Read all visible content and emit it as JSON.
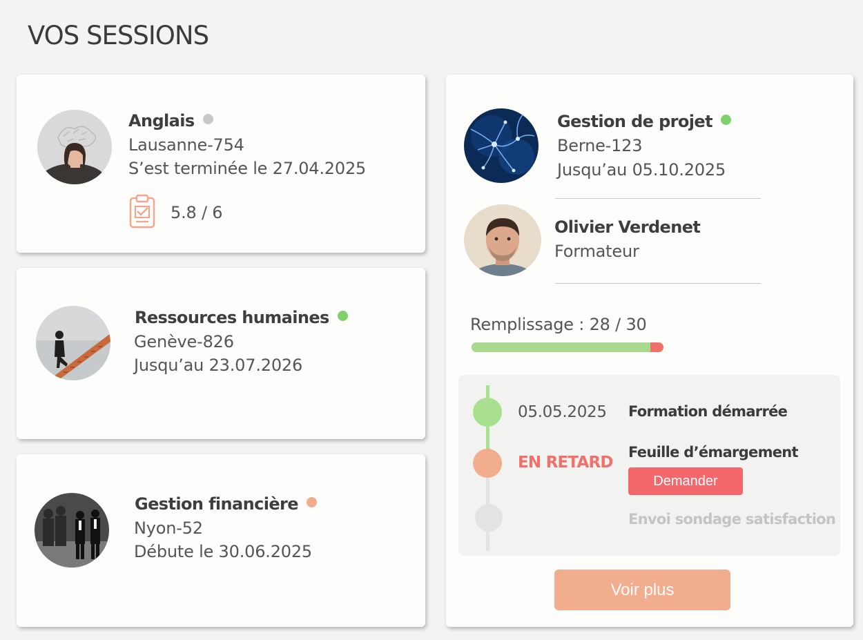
{
  "page": {
    "title": "VOS SESSIONS"
  },
  "colors": {
    "status_done": "#c8c8c8",
    "status_active": "#7fd26b",
    "status_upcoming": "#f2ad8f",
    "late": "#f0706c",
    "accent_button": "#f4676b",
    "primary_button": "#f2ad8f"
  },
  "sessions": [
    {
      "title": "Anglais",
      "code": "Lausanne-754",
      "date_text": "S’est terminée le 27.04.2025",
      "status": "done",
      "score": "5.8 / 6",
      "score_icon": "clipboard-check-icon"
    },
    {
      "title": "Ressources humaines",
      "code": "Genève-826",
      "date_text": "Jusqu’au 23.07.2026",
      "status": "active"
    },
    {
      "title": "Gestion financière",
      "code": "Nyon-52",
      "date_text": "Débute le 30.06.2025",
      "status": "upcoming"
    }
  ],
  "detail": {
    "title": "Gestion de projet",
    "code": "Berne-123",
    "date_text": "Jusqu’au 05.10.2025",
    "status": "active",
    "trainer": {
      "name": "Olivier Verdenet",
      "role": "Formateur"
    },
    "fill": {
      "label": "Remplissage : 28 / 30",
      "filled": 28,
      "total": 30
    },
    "timeline": [
      {
        "date": "05.05.2025",
        "label": "Formation démarrée",
        "state": "done"
      },
      {
        "date": "EN RETARD",
        "label": "Feuille d’émargement",
        "state": "late",
        "action": "Demander"
      },
      {
        "date": "",
        "label": "Envoi sondage satisfaction",
        "state": "pending"
      }
    ],
    "more_button": "Voir plus"
  }
}
